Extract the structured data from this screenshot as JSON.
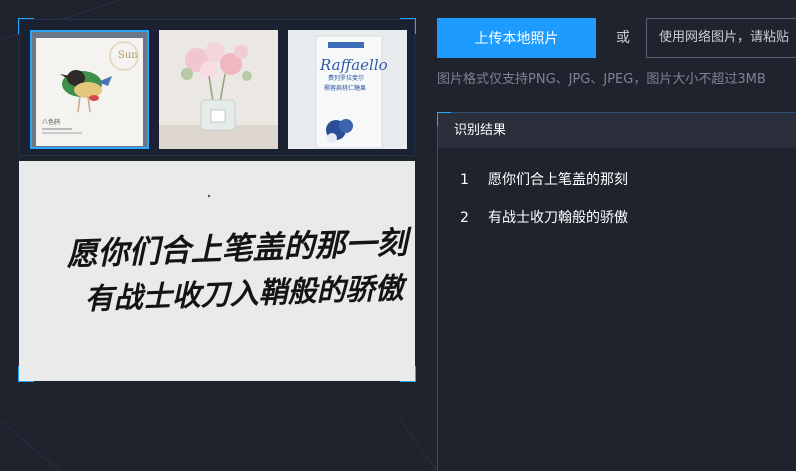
{
  "upload": {
    "button_label": "上传本地照片",
    "or_label": "或",
    "url_placeholder": "使用网络图片，请粘贴"
  },
  "hint": "图片格式仅支持PNG、JPG、JPEG，图片大小不超过3MB",
  "thumbnails": [
    {
      "name": "bird-card",
      "card_title": "Sun",
      "card_sub": "八色鸫"
    },
    {
      "name": "flower-vase"
    },
    {
      "name": "raffaello-box",
      "brand": "Raffaello",
      "brand_sub": "费列罗拉斐尔",
      "brand_line": "椰蓉扁桃仁糖果"
    }
  ],
  "main_preview": {
    "line1": "愿你们合上笔盖的那一刻",
    "line2": "有战士收刀入鞘般的骄傲"
  },
  "results": {
    "title": "识别结果",
    "items": [
      {
        "num": "1",
        "text": "愿你们合上笔盖的那刻"
      },
      {
        "num": "2",
        "text": "有战士收刀翰般的骄傲"
      }
    ]
  },
  "colors": {
    "accent": "#1e9bff",
    "background": "#1f232d",
    "panel_header": "#2a2f3b"
  }
}
